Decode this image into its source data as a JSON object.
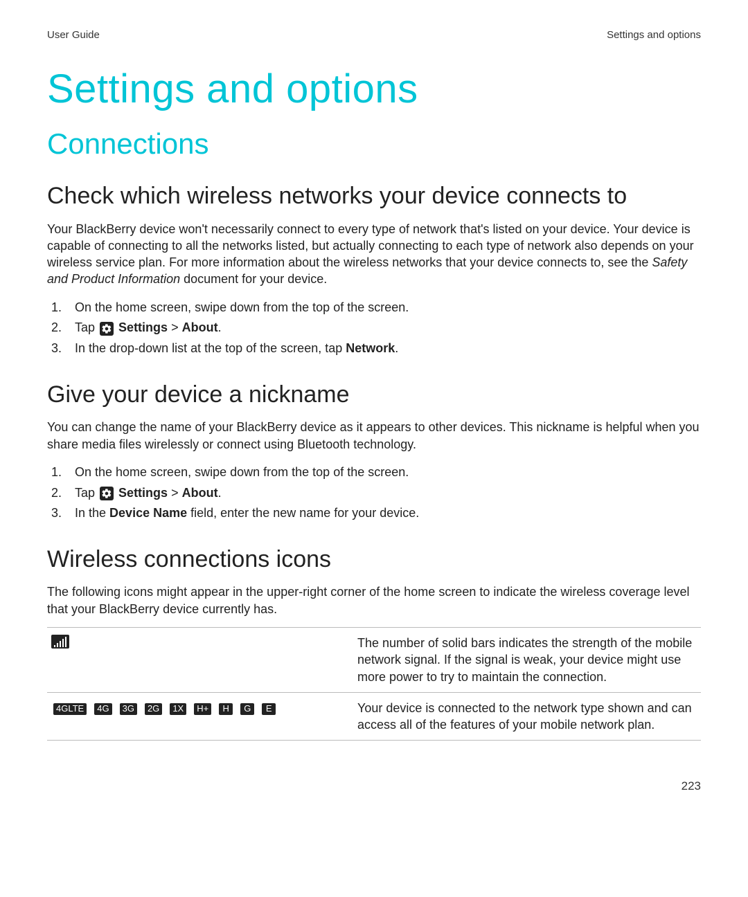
{
  "header": {
    "left": "User Guide",
    "right": "Settings and options"
  },
  "title": "Settings and options",
  "section": "Connections",
  "sub1": {
    "heading": "Check which wireless networks your device connects to",
    "para_a": "Your BlackBerry device won't necessarily connect to every type of network that's listed on your device. Your device is capable of connecting to all the networks listed, but actually connecting to each type of network also depends on your wireless service plan. For more information about the wireless networks that your device connects to, see the ",
    "para_b_italic": "Safety and Product Information",
    "para_c": " document for your device.",
    "steps": {
      "s1": "On the home screen, swipe down from the top of the screen.",
      "s2_tap": "Tap ",
      "s2_settings": " Settings",
      "s2_gt": " > ",
      "s2_about": "About",
      "s2_end": ".",
      "s3_a": "In the drop-down list at the top of the screen, tap ",
      "s3_b": "Network",
      "s3_c": "."
    }
  },
  "sub2": {
    "heading": "Give your device a nickname",
    "para": "You can change the name of your BlackBerry device as it appears to other devices. This nickname is helpful when you share media files wirelessly or connect using Bluetooth technology.",
    "steps": {
      "s1": "On the home screen, swipe down from the top of the screen.",
      "s2_tap": "Tap ",
      "s2_settings": " Settings",
      "s2_gt": " > ",
      "s2_about": "About",
      "s2_end": ".",
      "s3_a": "In the ",
      "s3_b": "Device Name",
      "s3_c": " field, enter the new name for your device."
    }
  },
  "sub3": {
    "heading": "Wireless connections icons",
    "para": "The following icons might appear in the upper-right corner of the home screen to indicate the wireless coverage level that your BlackBerry device currently has.",
    "rows": {
      "r1_desc": "The number of solid bars indicates the strength of the mobile network signal. If the signal is weak, your device might use more power to try to maintain the connection.",
      "r2_desc": "Your device is connected to the network type shown and can access all of the features of your mobile network plan.",
      "net": {
        "a": "4GLTE",
        "b": "4G",
        "c": "3G",
        "d": "2G",
        "e": "1X",
        "f": "H+",
        "g": "H",
        "h": "G",
        "i": "E"
      }
    }
  },
  "page_number": "223"
}
